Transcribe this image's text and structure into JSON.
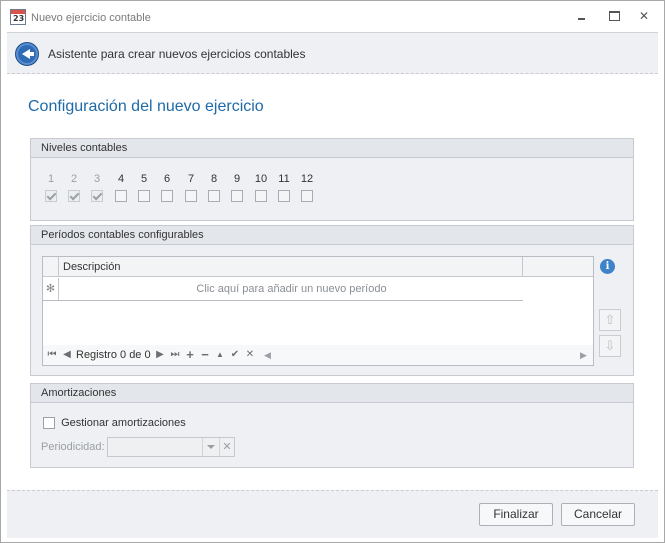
{
  "window": {
    "title": "Nuevo ejercicio contable",
    "icon_label": "23",
    "close_glyph": "✕"
  },
  "wizard": {
    "header_title": "Asistente para crear nuevos ejercicios contables",
    "page_title": "Configuración del nuevo ejercicio"
  },
  "niveles": {
    "title": "Niveles contables",
    "levels": [
      {
        "label": "1",
        "checked": true,
        "enabled": false
      },
      {
        "label": "2",
        "checked": true,
        "enabled": false
      },
      {
        "label": "3",
        "checked": true,
        "enabled": false
      },
      {
        "label": "4",
        "checked": false,
        "enabled": true
      },
      {
        "label": "5",
        "checked": false,
        "enabled": true
      },
      {
        "label": "6",
        "checked": false,
        "enabled": true
      },
      {
        "label": "7",
        "checked": false,
        "enabled": true
      },
      {
        "label": "8",
        "checked": false,
        "enabled": true
      },
      {
        "label": "9",
        "checked": false,
        "enabled": true
      },
      {
        "label": "10",
        "checked": false,
        "enabled": true
      },
      {
        "label": "11",
        "checked": false,
        "enabled": true
      },
      {
        "label": "12",
        "checked": false,
        "enabled": true
      }
    ]
  },
  "periodos": {
    "title": "Períodos contables configurables",
    "column_description": "Descripción",
    "new_row_indicator": "✻",
    "new_row_hint": "Clic aquí para añadir un nuevo período",
    "navigator": {
      "first": "⏮",
      "prev": "◀",
      "record_text": "Registro 0 de 0",
      "next": "▶",
      "last": "⏭",
      "append": "+",
      "delete": "−",
      "edit": "▲",
      "post": "✔",
      "cancel": "✕",
      "scroll_left": "◀",
      "scroll_right": "▶"
    },
    "info_glyph": "i",
    "move_up_glyph": "⇧",
    "move_down_glyph": "⇩"
  },
  "amortizaciones": {
    "title": "Amortizaciones",
    "manage_label": "Gestionar amortizaciones",
    "manage_checked": false,
    "periodicity_label": "Periodicidad:",
    "periodicity_value": "",
    "clear_glyph": "✕"
  },
  "buttons": {
    "finish": "Finalizar",
    "cancel": "Cancelar"
  },
  "colors": {
    "accent": "#1e6aa8",
    "back_button": "#2e6db5",
    "info_icon": "#3f82c8"
  }
}
